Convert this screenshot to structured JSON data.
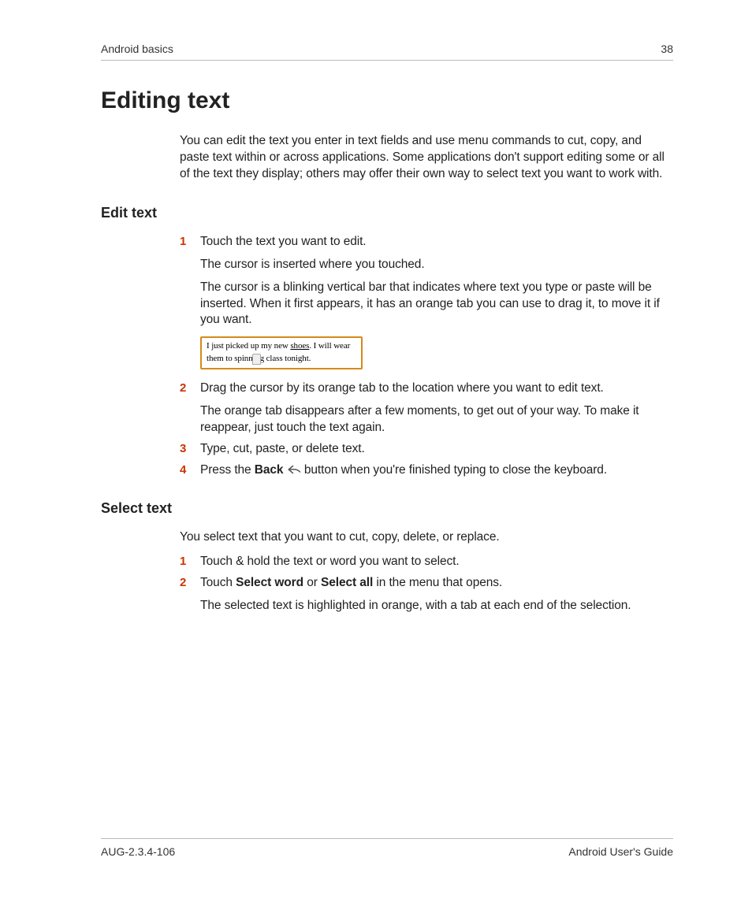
{
  "header": {
    "section": "Android basics",
    "page_number": "38"
  },
  "title": "Editing text",
  "intro": "You can edit the text you enter in text fields and use menu commands to cut, copy, and paste text within or across applications. Some applications don't support editing some or all of the text they display; others may offer their own way to select text you want to work with.",
  "sections": {
    "edit": {
      "heading": "Edit text",
      "step1": "Touch the text you want to edit.",
      "step1_p1": "The cursor is inserted where you touched.",
      "step1_p2": "The cursor is a blinking vertical bar that indicates where text you type or paste will be inserted. When it first appears, it has an orange tab you can use to drag it, to move it if you want.",
      "sample_pre": "I just picked up my new ",
      "sample_underlined": "shoes",
      "sample_post1": ". I will wear them to spinn",
      "sample_post2": "g class tonight.",
      "step2": "Drag the cursor by its orange tab to the location where you want to edit text.",
      "step2_p1": "The orange tab disappears after a few moments, to get out of your way. To make it reappear, just touch the text again.",
      "step3": "Type, cut, paste, or delete text.",
      "step4_pre": "Press the ",
      "step4_bold": "Back",
      "step4_post": " button when you're finished typing to close the keyboard."
    },
    "select": {
      "heading": "Select text",
      "lead": "You select text that you want to cut, copy, delete, or replace.",
      "step1": "Touch & hold the text or word you want to select.",
      "step2_pre": "Touch ",
      "step2_b1": "Select word",
      "step2_mid": " or ",
      "step2_b2": "Select all",
      "step2_post": " in the menu that opens.",
      "step2_p1": "The selected text is highlighted in orange, with a tab at each end of the selection."
    }
  },
  "footer": {
    "left": "AUG-2.3.4-106",
    "right": "Android User's Guide"
  },
  "nums": {
    "n1": "1",
    "n2": "2",
    "n3": "3",
    "n4": "4"
  }
}
